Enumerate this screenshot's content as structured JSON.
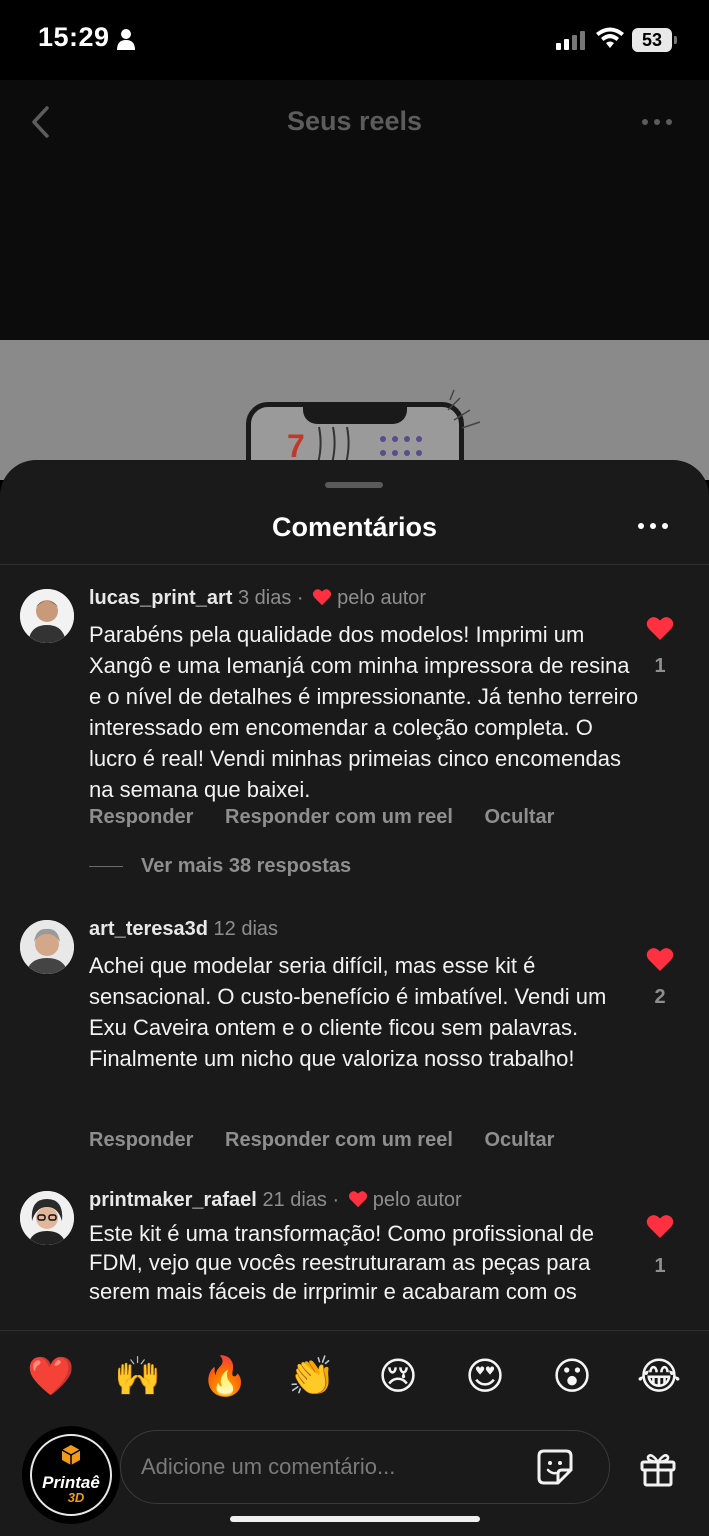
{
  "status_bar": {
    "time": "15:29",
    "battery": "53"
  },
  "header": {
    "title": "Seus reels",
    "back_icon": "chevron-left-icon",
    "more_icon": "more-horizontal-icon"
  },
  "sheet": {
    "title": "Comentários"
  },
  "comments": [
    {
      "username": "lucas_print_art",
      "time": "3 dias",
      "liked_by_author": "pelo autor",
      "text": "Parabéns pela qualidade dos modelos! Imprimi um Xangô e uma Iemanjá com minha impressora de resina e o nível de detalhes é impressionante. Já tenho terreiro interessado em encomendar a coleção completa. O lucro é real! Vendi minhas primeias cinco encomendas na semana que baixei.",
      "likes": "1",
      "reply_label": "Responder",
      "reel_label": "Responder com um reel",
      "hide_label": "Ocultar",
      "more_replies": "Ver mais 38 respostas"
    },
    {
      "username": "art_teresa3d",
      "time": "12 dias",
      "text": "Achei que modelar seria difícil, mas esse kit é sensacional. O custo-benefício é imbatível. Vendi um Exu Caveira ontem e o cliente ficou sem palavras. Finalmente um nicho que valoriza nosso trabalho!",
      "likes": "2",
      "reply_label": "Responder",
      "reel_label": "Responder com um reel",
      "hide_label": "Ocultar"
    },
    {
      "username": "printmaker_rafael",
      "time": "21 dias",
      "liked_by_author": "pelo autor",
      "text": "Este kit é uma transformação! Como profissional de FDM, vejo que vocês reestruturaram as peças para serem mais fáceis de irrprimir e acabaram com os",
      "likes": "1"
    }
  ],
  "emoji_bar": [
    "❤️",
    "🙌",
    "🔥",
    "👏",
    "😢",
    "😍",
    "😮",
    "😂"
  ],
  "input": {
    "placeholder": "Adicione um comentário...",
    "logo_text": "Printaê",
    "logo_sub": "3D"
  },
  "colors": {
    "heart": "#ff3040",
    "sheet_bg": "#1a1a1a",
    "muted": "#8e8e8e"
  }
}
